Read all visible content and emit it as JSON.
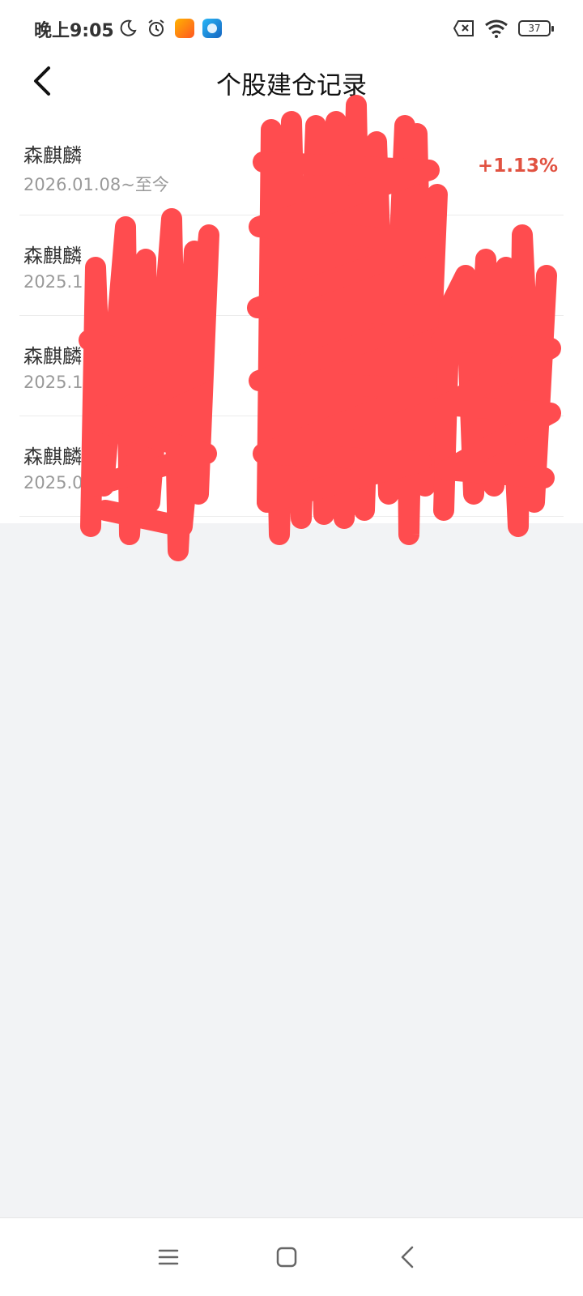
{
  "status_bar": {
    "time": "晚上9:05",
    "battery": "37",
    "left_icons": [
      "moon-icon",
      "alarm-icon",
      "app-badge-orange",
      "app-badge-blue"
    ],
    "right_icons": [
      "sim-off-icon",
      "wifi-icon",
      "battery-icon"
    ]
  },
  "header": {
    "title": "个股建仓记录",
    "back_icon": "chevron-left-icon"
  },
  "records": [
    {
      "name": "森麒麟",
      "period": "2026.01.08~至今",
      "change": "+1.13%"
    },
    {
      "name": "森麒麟",
      "period": "2025.1",
      "change": ""
    },
    {
      "name": "森麒麟",
      "period": "2025.12",
      "change": ""
    },
    {
      "name": "森麒麟",
      "period": "2025.02",
      "change": ""
    }
  ],
  "colors": {
    "accent_red": "#e15241",
    "redaction": "#ff4c4f",
    "background": "#f2f3f5"
  },
  "nav": {
    "icons": [
      "menu-icon",
      "home-square-icon",
      "back-chevron-icon"
    ]
  }
}
